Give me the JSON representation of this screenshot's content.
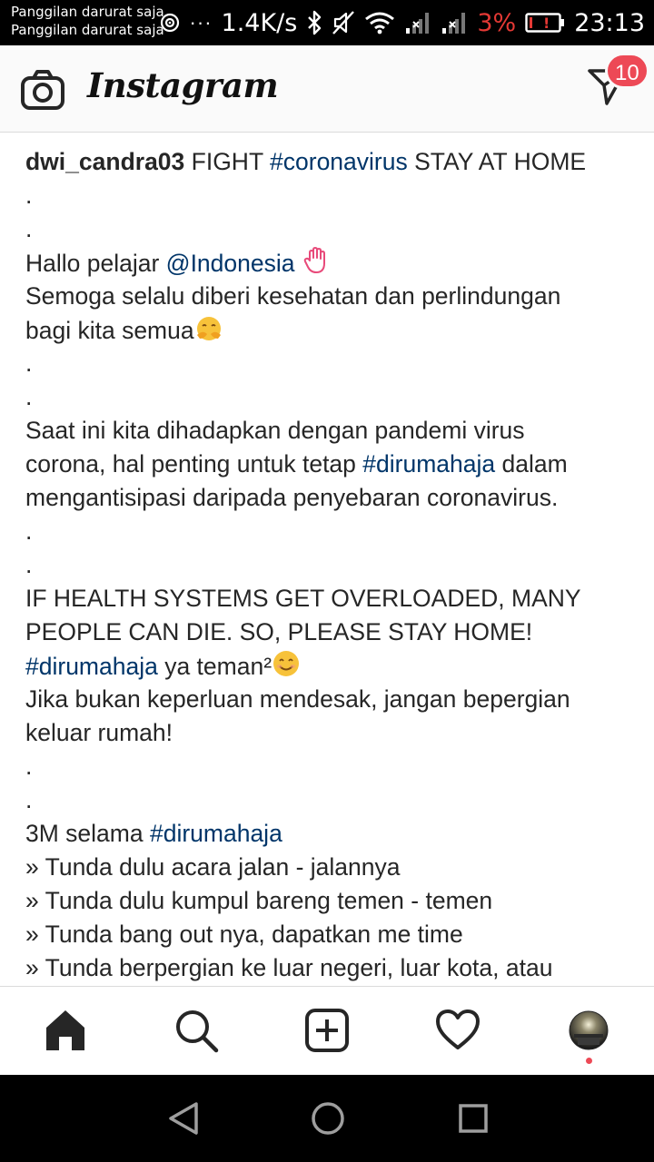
{
  "status_bar": {
    "carrier_line_1": "Panggilan darurat saja",
    "carrier_line_2": "Panggilan darurat saja",
    "more": "···",
    "network_speed": "1.4K/s",
    "battery_percent": "3%",
    "time": "23:13"
  },
  "header": {
    "logo": "Instagram",
    "dm_badge_count": "10",
    "icons": [
      "camera-icon",
      "direct-message-icon"
    ]
  },
  "post": {
    "username": "dwi_candra03",
    "caption_lines": [
      [
        {
          "t": "dwi_candra03",
          "k": "user"
        },
        {
          "t": " FIGHT "
        },
        {
          "t": "#coronavirus",
          "k": "tag"
        },
        {
          "t": " STAY AT HOME"
        }
      ],
      [
        {
          "t": "."
        }
      ],
      [
        {
          "t": "."
        }
      ],
      [
        {
          "t": "Hallo pelajar "
        },
        {
          "t": "@Indonesia",
          "k": "tag"
        },
        {
          "t": " "
        },
        {
          "e": "wave"
        }
      ],
      [
        {
          "t": "Semoga selalu diberi kesehatan dan perlindungan"
        }
      ],
      [
        {
          "t": "bagi kita semua"
        },
        {
          "e": "hug"
        }
      ],
      [
        {
          "t": "."
        }
      ],
      [
        {
          "t": "."
        }
      ],
      [
        {
          "t": "Saat ini kita dihadapkan dengan pandemi virus"
        }
      ],
      [
        {
          "t": "corona, hal penting untuk tetap "
        },
        {
          "t": "#dirumahaja",
          "k": "tag"
        },
        {
          "t": " dalam"
        }
      ],
      [
        {
          "t": "mengantisipasi daripada penyebaran coronavirus."
        }
      ],
      [
        {
          "t": "."
        }
      ],
      [
        {
          "t": "."
        }
      ],
      [
        {
          "t": "IF HEALTH SYSTEMS GET OVERLOADED, MANY"
        }
      ],
      [
        {
          "t": "PEOPLE CAN DIE. SO, PLEASE STAY HOME!"
        }
      ],
      [
        {
          "t": "#dirumahaja",
          "k": "tag"
        },
        {
          "t": " ya teman²"
        },
        {
          "e": "smile"
        }
      ],
      [
        {
          "t": "Jika bukan keperluan mendesak, jangan bepergian"
        }
      ],
      [
        {
          "t": "keluar rumah!"
        }
      ],
      [
        {
          "t": "."
        }
      ],
      [
        {
          "t": "."
        }
      ],
      [
        {
          "t": "3M selama "
        },
        {
          "t": "#dirumahaja",
          "k": "tag"
        }
      ],
      [
        {
          "t": "» Tunda dulu acara jalan - jalannya"
        }
      ],
      [
        {
          "t": "» Tunda dulu kumpul bareng temen - temen"
        }
      ],
      [
        {
          "t": "» Tunda bang out nya, dapatkan me time"
        }
      ],
      [
        {
          "t": "» Tunda berpergian ke luar negeri, luar kota, atau"
        }
      ]
    ]
  },
  "bottom_nav": {
    "items": [
      "home-icon",
      "search-icon",
      "new-post-icon",
      "activity-heart-icon",
      "profile-avatar"
    ]
  },
  "android_nav": {
    "items": [
      "back-icon",
      "home-circle-icon",
      "recents-icon"
    ]
  },
  "colors": {
    "hashtag": "#003569",
    "badge": "#ed4956",
    "text": "#262626",
    "battery_low": "#e53935"
  }
}
